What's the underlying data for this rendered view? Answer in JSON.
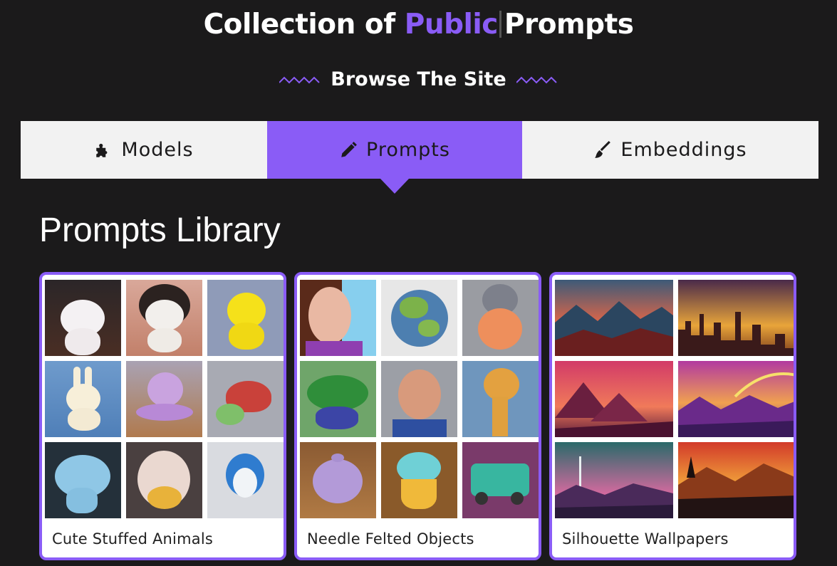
{
  "header": {
    "title_prefix": "Collection of ",
    "title_accent": "Public",
    "title_suffix": "Prompts",
    "browse": "Browse The Site"
  },
  "tabs": [
    {
      "label": "Models",
      "icon": "puzzle-icon"
    },
    {
      "label": "Prompts",
      "icon": "pencil-icon",
      "active": true
    },
    {
      "label": "Embeddings",
      "icon": "brush-icon"
    }
  ],
  "library": {
    "title": "Prompts Library",
    "cards": [
      {
        "label": "Cute Stuffed Animals"
      },
      {
        "label": "Needle Felted Objects"
      },
      {
        "label": "Silhouette Wallpapers"
      }
    ]
  },
  "colors": {
    "accent": "#8a5cf6",
    "background": "#1b1a1b",
    "tab_bg": "#f2f2f2"
  }
}
